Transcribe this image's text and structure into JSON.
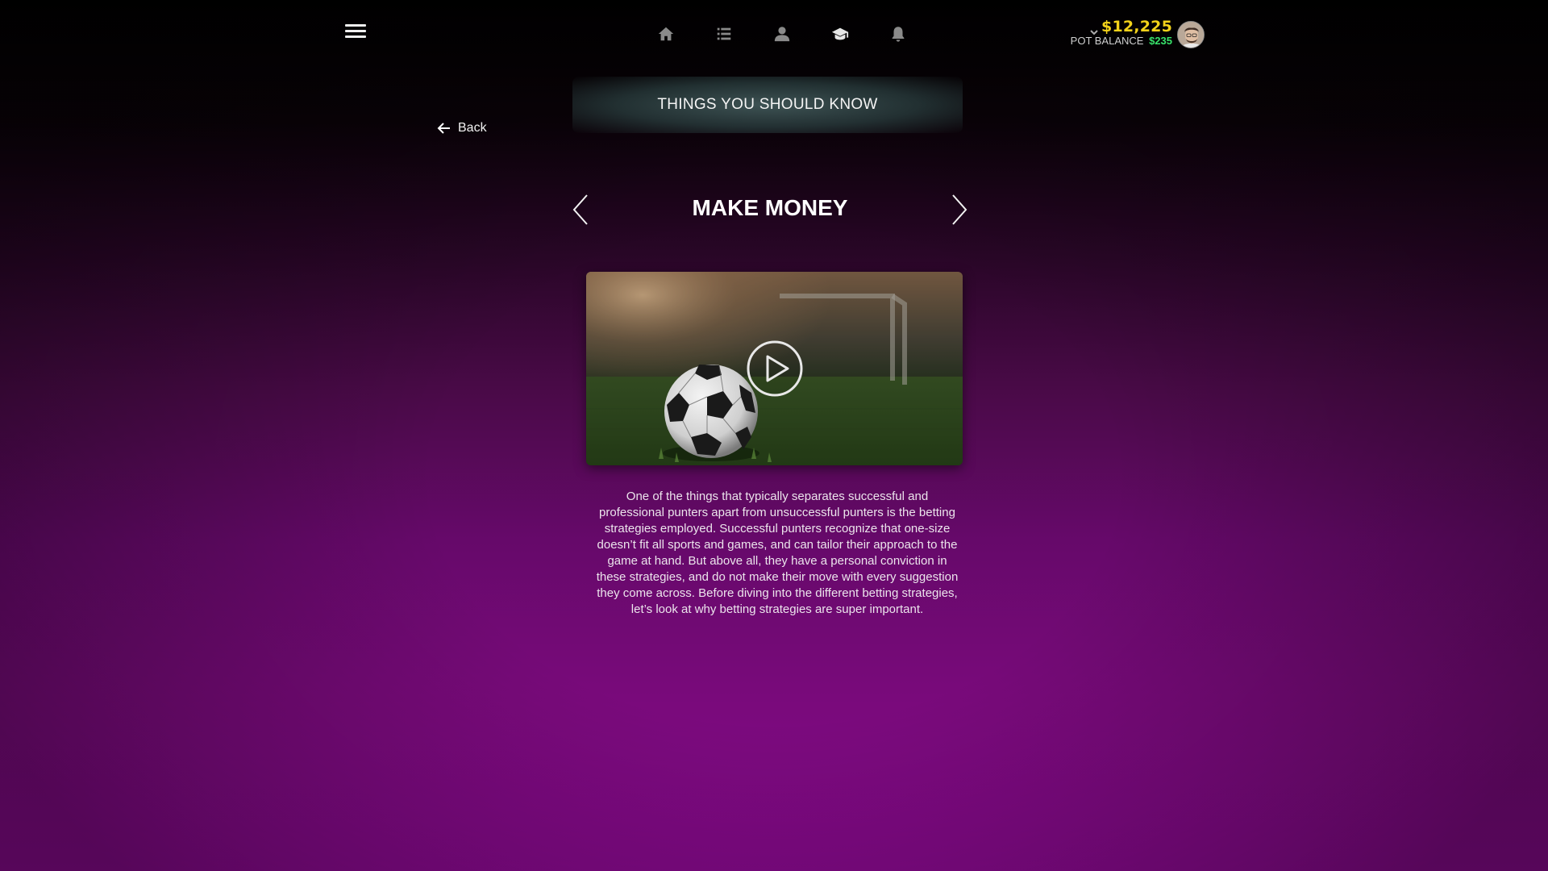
{
  "topnav": {
    "menu_icon": "hamburger-menu-icon",
    "icons": [
      {
        "name": "home-icon",
        "active": false
      },
      {
        "name": "list-icon",
        "active": false
      },
      {
        "name": "user-icon",
        "active": false
      },
      {
        "name": "graduation-cap-icon",
        "active": true
      },
      {
        "name": "bell-icon",
        "active": false
      }
    ]
  },
  "account": {
    "balance": "$12,225",
    "pot_label": "POT BALANCE",
    "pot_value": "$235",
    "balance_color": "#f2d21a",
    "pot_color": "#38e36a"
  },
  "back": {
    "label": "Back"
  },
  "section": {
    "header": "THINGS YOU SHOULD KNOW"
  },
  "article": {
    "title": "MAKE MONEY",
    "body": "One of the things that typically separates successful and professional punters apart from unsuccessful punters is the betting strategies employed. Successful punters recognize that one-size doesn’t fit all sports and games, and can tailor their approach to the game at hand. But above all, they have a personal conviction in these strategies, and do not make their move with every suggestion they come across. Before diving into the different betting strategies, let’s look at why betting strategies are super important."
  },
  "video": {
    "thumbnail": "soccer-ball-on-grass",
    "play_icon": "play-icon"
  }
}
